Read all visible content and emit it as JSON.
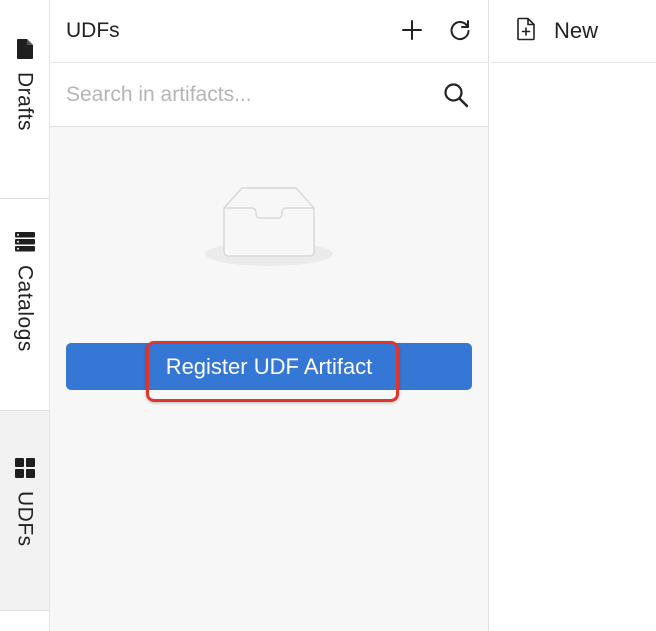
{
  "rail": {
    "tabs": [
      {
        "label": "Drafts",
        "icon": "file-icon",
        "active": false
      },
      {
        "label": "Catalogs",
        "icon": "server-icon",
        "active": false
      },
      {
        "label": "UDFs",
        "icon": "grid-icon",
        "active": true
      }
    ]
  },
  "panel": {
    "title": "UDFs",
    "add_icon": "plus-icon",
    "refresh_icon": "refresh-icon",
    "search": {
      "placeholder": "Search in artifacts...",
      "value": "",
      "icon": "search-icon"
    },
    "empty_icon": "empty-inbox-icon",
    "register_button": "Register UDF Artifact"
  },
  "editor": {
    "new_tab_label": "New",
    "new_tab_icon": "new-file-icon"
  },
  "colors": {
    "accent": "#3577d4",
    "highlight": "#e0342f",
    "panel_bg": "#f7f7f7",
    "active_rail_bg": "#f2f2f2"
  }
}
